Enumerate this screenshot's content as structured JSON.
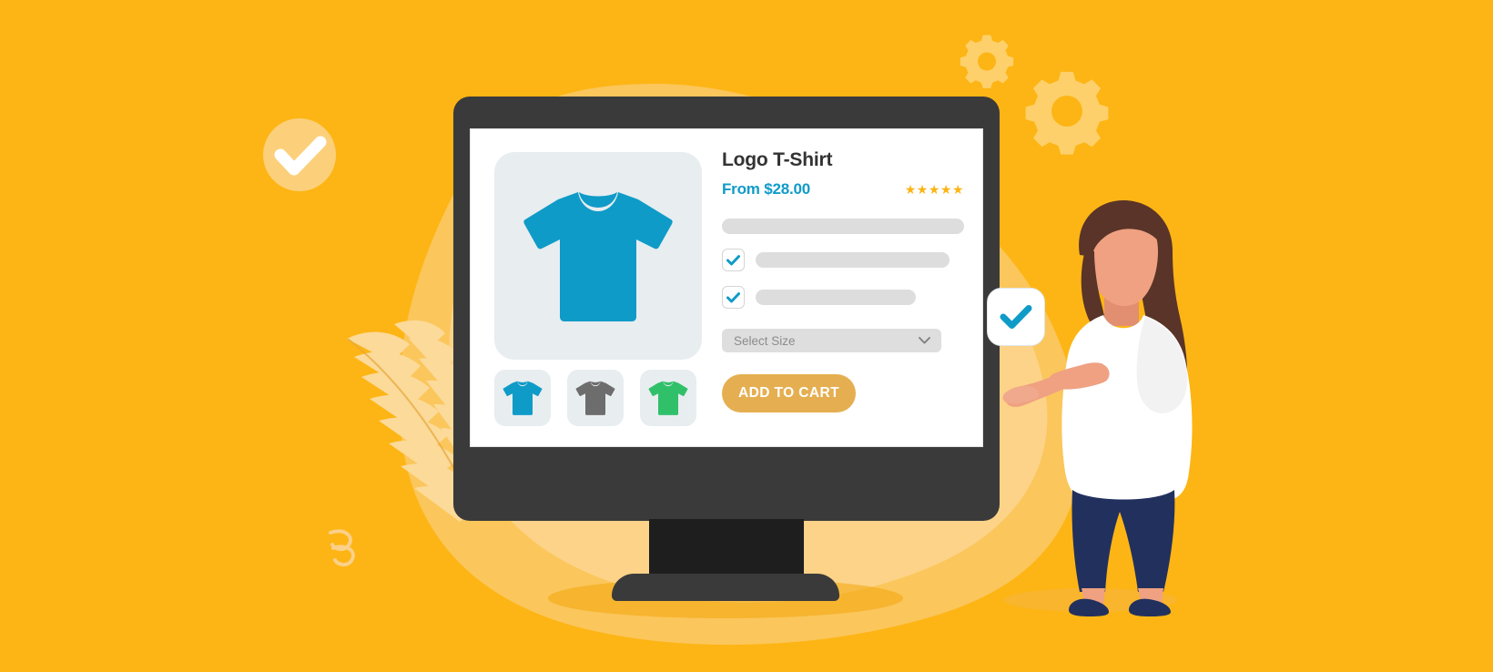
{
  "scene": {
    "title": "E-commerce product page illustration",
    "background_color": "#FDB515"
  },
  "decorations": {
    "blob_color": "#FBC65B",
    "blob_light_color": "#FCD388",
    "gear_color": "#FDD06B",
    "gear_small_label": "gear-icon-small",
    "gear_large_label": "gear-icon-large",
    "check_circle_color": "#FCD07A",
    "check_circle_mark_color": "#FFFFFF",
    "leaf_color": "#FBDA9A",
    "squiggle_color": "#FBD089"
  },
  "monitor": {
    "body_color": "#3A3A3A",
    "neck_color": "#1E1E1E",
    "screen_color": "#FFFFFF"
  },
  "product": {
    "title": "Logo T-Shirt",
    "price": "From $28.00",
    "rating_stars": "★★★★★",
    "rating_value": 5,
    "rating_max": 5,
    "star_color": "#FCB414",
    "price_color": "#0F9BC8",
    "hero_image_label": "Blue logo t-shirt product image",
    "hero_shirt_color": "#0F9BC8",
    "thumbnails": [
      {
        "name": "thumbnail-blue-shirt",
        "color": "#0F9BC8",
        "label": "Blue"
      },
      {
        "name": "thumbnail-gray-shirt",
        "color": "#6D6D6D",
        "label": "Gray"
      },
      {
        "name": "thumbnail-green-shirt",
        "color": "#31C06A",
        "label": "Green"
      }
    ],
    "options": [
      {
        "checked": true,
        "placeholder_width": "80%"
      },
      {
        "checked": true,
        "placeholder_width": "66%"
      }
    ],
    "description_placeholder_width": "100%",
    "size_select": {
      "placeholder": "Select Size",
      "value": "",
      "chevron": "chevron-down-icon"
    },
    "add_to_cart_label": "ADD TO CART",
    "add_to_cart_color": "#E5AF51"
  },
  "floating_checkbox": {
    "checked": true,
    "check_color": "#0F9BC8",
    "label": "floating checkbox being tapped"
  },
  "character": {
    "label": "woman pointing at checkbox",
    "hair_color": "#5A3428",
    "skin_color": "#EFA182",
    "shirt_color": "#FFFFFF",
    "pants_color": "#22305E",
    "shoes_color": "#22305E"
  }
}
